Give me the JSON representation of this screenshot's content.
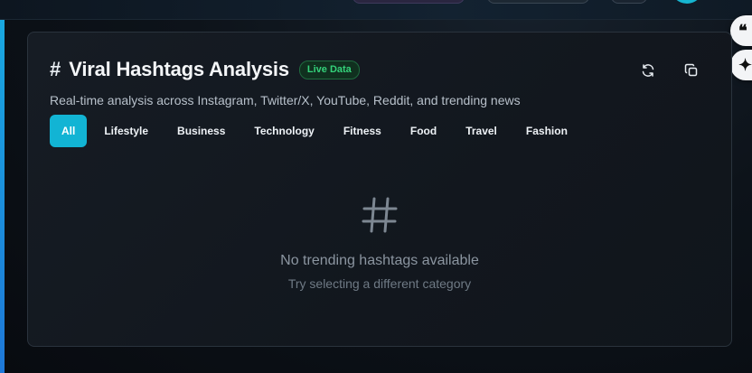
{
  "card": {
    "title": "Viral Hashtags Analysis",
    "badge": "Live Data",
    "subtitle": "Real-time analysis across Instagram, Twitter/X, YouTube, Reddit, and trending news",
    "tabs": [
      {
        "label": "All",
        "active": true
      },
      {
        "label": "Lifestyle"
      },
      {
        "label": "Business"
      },
      {
        "label": "Technology"
      },
      {
        "label": "Fitness"
      },
      {
        "label": "Food"
      },
      {
        "label": "Travel"
      },
      {
        "label": "Fashion"
      }
    ],
    "empty_state": {
      "title": "No trending hashtags available",
      "hint": "Try selecting a different category"
    }
  },
  "icons": {
    "header": "hash-icon",
    "refresh": "refresh-icon",
    "copy": "copy-icon",
    "empty": "hash-icon",
    "float_one": "quote-icon",
    "float_two": "sparkle-icon"
  },
  "colors": {
    "accent": "#12b4d4",
    "badge_text": "#34d27a",
    "badge_bg": "#10301f",
    "card_bg": "#161c24",
    "page_bg": "#0b1016"
  }
}
